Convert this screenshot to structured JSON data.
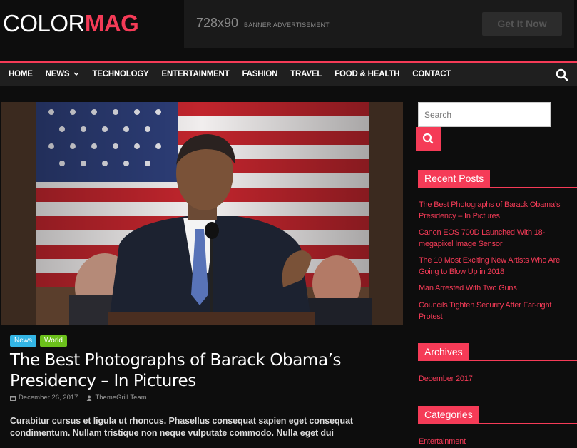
{
  "header": {
    "logo_left": "COLOR",
    "logo_right": "MAG",
    "banner_size": "728x90",
    "banner_label": "BANNER ADVERTISEMENT",
    "banner_button": "Get It Now"
  },
  "nav": {
    "items": [
      "HOME",
      "NEWS",
      "TECHNOLOGY",
      "ENTERTAINMENT",
      "FASHION",
      "TRAVEL",
      "FOOD & HEALTH",
      "CONTACT"
    ]
  },
  "post": {
    "tags": [
      {
        "label": "News",
        "color": "#33b5e5"
      },
      {
        "label": "World",
        "color": "#6bc01b"
      }
    ],
    "title": "The Best Photographs of Barack Obama’s Presidency – In Pictures",
    "date": "December 26, 2017",
    "author": "ThemeGrill Team",
    "excerpt": "Curabitur cursus et ligula ut rhoncus. Phasellus consequat sapien eget consequat condimentum. Nullam tristique non neque vulputate commodo. Nulla eget dui"
  },
  "sidebar": {
    "search_placeholder": "Search",
    "recent_title": "Recent Posts",
    "recent": [
      "The Best Photographs of Barack Obama’s Presidency – In Pictures",
      "Canon EOS 700D Launched With 18-megapixel Image Sensor",
      "The 10 Most Exciting New Artists Who Are Going to Blow Up in 2018",
      "Man Arrested With Two Guns",
      "Councils Tighten Security After Far-right Protest"
    ],
    "archives_title": "Archives",
    "archives": [
      "December 2017"
    ],
    "categories_title": "Categories",
    "categories": [
      "Entertainment"
    ]
  },
  "colors": {
    "accent": "#f53b57",
    "background": "#0d0d0d",
    "nav_bg": "#1f1f1f"
  }
}
